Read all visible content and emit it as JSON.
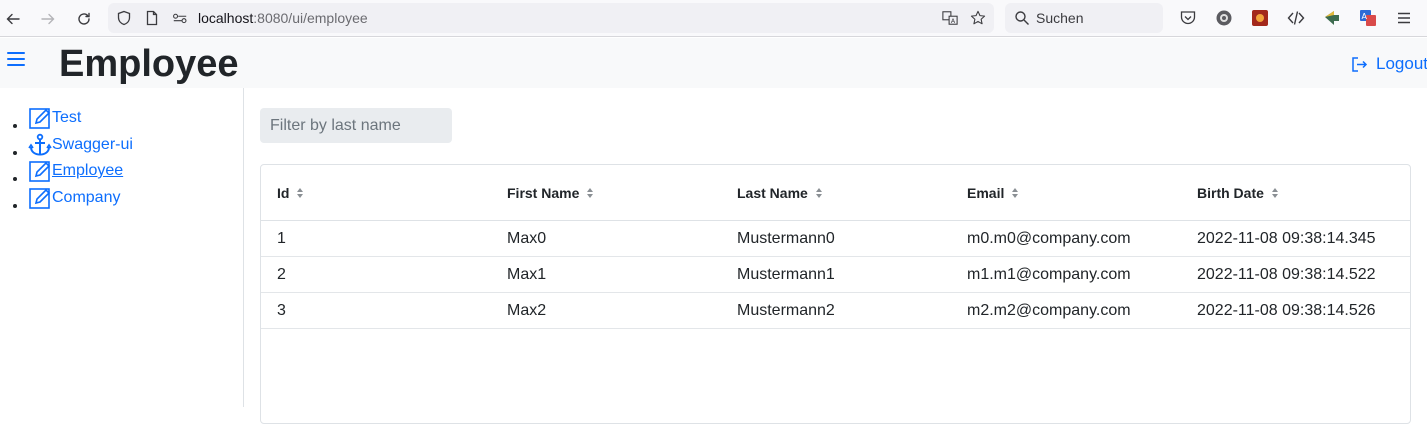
{
  "browser": {
    "url_host": "localhost",
    "url_rest": ":8080/ui/employee",
    "search_placeholder": "Suchen",
    "icons": [
      "back-icon",
      "forward-icon",
      "reload-icon",
      "shield-icon",
      "page-icon",
      "permissions-icon",
      "translate-icon",
      "bookmark-star-icon",
      "search-icon",
      "pocket-icon",
      "extension-gear-icon",
      "extension-orange-icon",
      "devtools-icon",
      "extension-arrow-icon",
      "extension-translate-icon",
      "menu-icon"
    ]
  },
  "header": {
    "title": "Employee",
    "logout_label": "Logout",
    "accent_color": "#0d6efd"
  },
  "sidebar": {
    "items": [
      {
        "label": "Test",
        "icon": "edit-icon",
        "active": false
      },
      {
        "label": "Swagger-ui",
        "icon": "anchor-icon",
        "active": false
      },
      {
        "label": "Employee",
        "icon": "edit-icon",
        "active": true
      },
      {
        "label": "Company",
        "icon": "edit-icon",
        "active": false
      }
    ]
  },
  "main": {
    "filter_placeholder": "Filter by last name",
    "table": {
      "columns": [
        "Id",
        "First Name",
        "Last Name",
        "Email",
        "Birth Date"
      ],
      "rows": [
        [
          "1",
          "Max0",
          "Mustermann0",
          "m0.m0@company.com",
          "2022-11-08 09:38:14.345"
        ],
        [
          "2",
          "Max1",
          "Mustermann1",
          "m1.m1@company.com",
          "2022-11-08 09:38:14.522"
        ],
        [
          "3",
          "Max2",
          "Mustermann2",
          "m2.m2@company.com",
          "2022-11-08 09:38:14.526"
        ]
      ]
    }
  }
}
